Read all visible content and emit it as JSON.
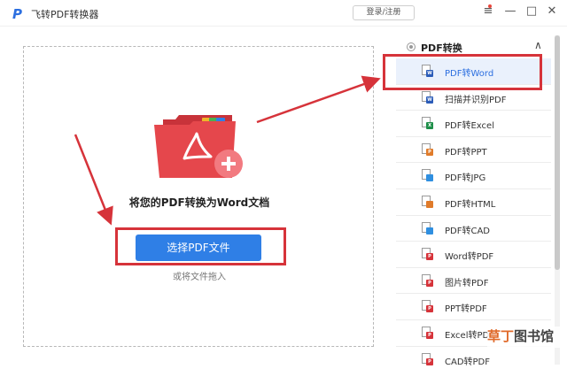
{
  "app": {
    "logo_letter": "P",
    "title": "飞转PDF转换器",
    "login_label": "登录/注册",
    "controls": {
      "menu": "≡",
      "minimize": "—",
      "maximize": "□",
      "close": "✕"
    }
  },
  "drop_zone": {
    "heading": "将您的PDF转换为Word文档",
    "choose_button": "选择PDF文件",
    "hint": "或将文件拖入"
  },
  "panel": {
    "title": "PDF转换",
    "items": [
      {
        "label": "PDF转Word",
        "icon": "word-file-icon",
        "color": "#2b5cb8",
        "tag": "W"
      },
      {
        "label": "扫描并识别PDF",
        "icon": "scan-file-icon",
        "color": "#2b5cb8",
        "tag": "W"
      },
      {
        "label": "PDF转Excel",
        "icon": "excel-file-icon",
        "color": "#1f8f4a",
        "tag": "X"
      },
      {
        "label": "PDF转PPT",
        "icon": "ppt-file-icon",
        "color": "#e07b2a",
        "tag": "P"
      },
      {
        "label": "PDF转JPG",
        "icon": "image-file-icon",
        "color": "#2f8fe0",
        "tag": ""
      },
      {
        "label": "PDF转HTML",
        "icon": "html-file-icon",
        "color": "#e07b2a",
        "tag": ""
      },
      {
        "label": "PDF转CAD",
        "icon": "cad-file-icon",
        "color": "#2f8fe0",
        "tag": ""
      },
      {
        "label": "Word转PDF",
        "icon": "word-to-pdf-icon",
        "color": "#d6333a",
        "tag": "P"
      },
      {
        "label": "图片转PDF",
        "icon": "image-to-pdf-icon",
        "color": "#d6333a",
        "tag": "P"
      },
      {
        "label": "PPT转PDF",
        "icon": "ppt-to-pdf-icon",
        "color": "#d6333a",
        "tag": "P"
      },
      {
        "label": "Excel转PDF",
        "icon": "excel-to-pdf-icon",
        "color": "#d6333a",
        "tag": "P"
      },
      {
        "label": "CAD转PDF",
        "icon": "cad-to-pdf-icon",
        "color": "#d6333a",
        "tag": "P"
      }
    ]
  },
  "watermark": {
    "part1": "草丁",
    "part2": "图书馆"
  },
  "colors": {
    "accent": "#2f7fe6",
    "annotation": "#d6333a",
    "folder": "#e5474c"
  }
}
